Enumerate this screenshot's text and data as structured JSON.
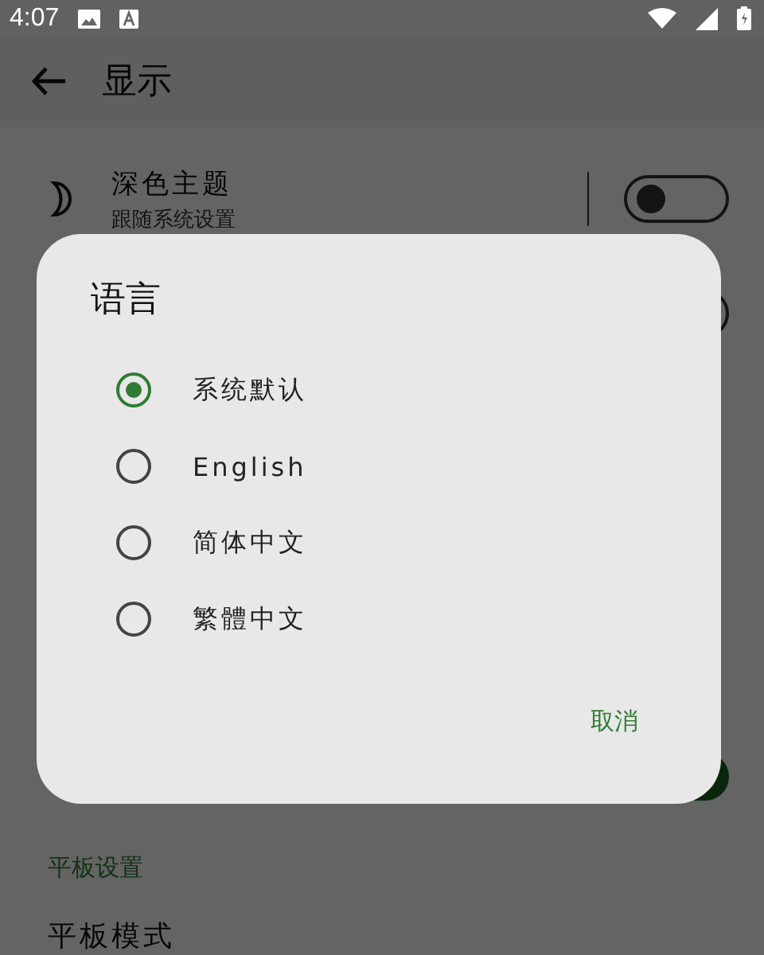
{
  "status_bar": {
    "time": "4:07"
  },
  "app_bar": {
    "title": "显示"
  },
  "settings": [
    {
      "kind": "toggle",
      "title": "深色主题",
      "subtitle": "跟随系统设置",
      "on": false
    },
    {
      "kind": "covered",
      "on": false
    },
    {
      "kind": "covered",
      "on": true
    }
  ],
  "section": {
    "title": "平板设置"
  },
  "tablet_row": {
    "title": "平板模式"
  },
  "dialog": {
    "title": "语言",
    "options": [
      {
        "label": "系统默认",
        "selected": true
      },
      {
        "label": "English",
        "selected": false
      },
      {
        "label": "简体中文",
        "selected": false
      },
      {
        "label": "繁體中文",
        "selected": false
      }
    ],
    "cancel": "取消"
  }
}
